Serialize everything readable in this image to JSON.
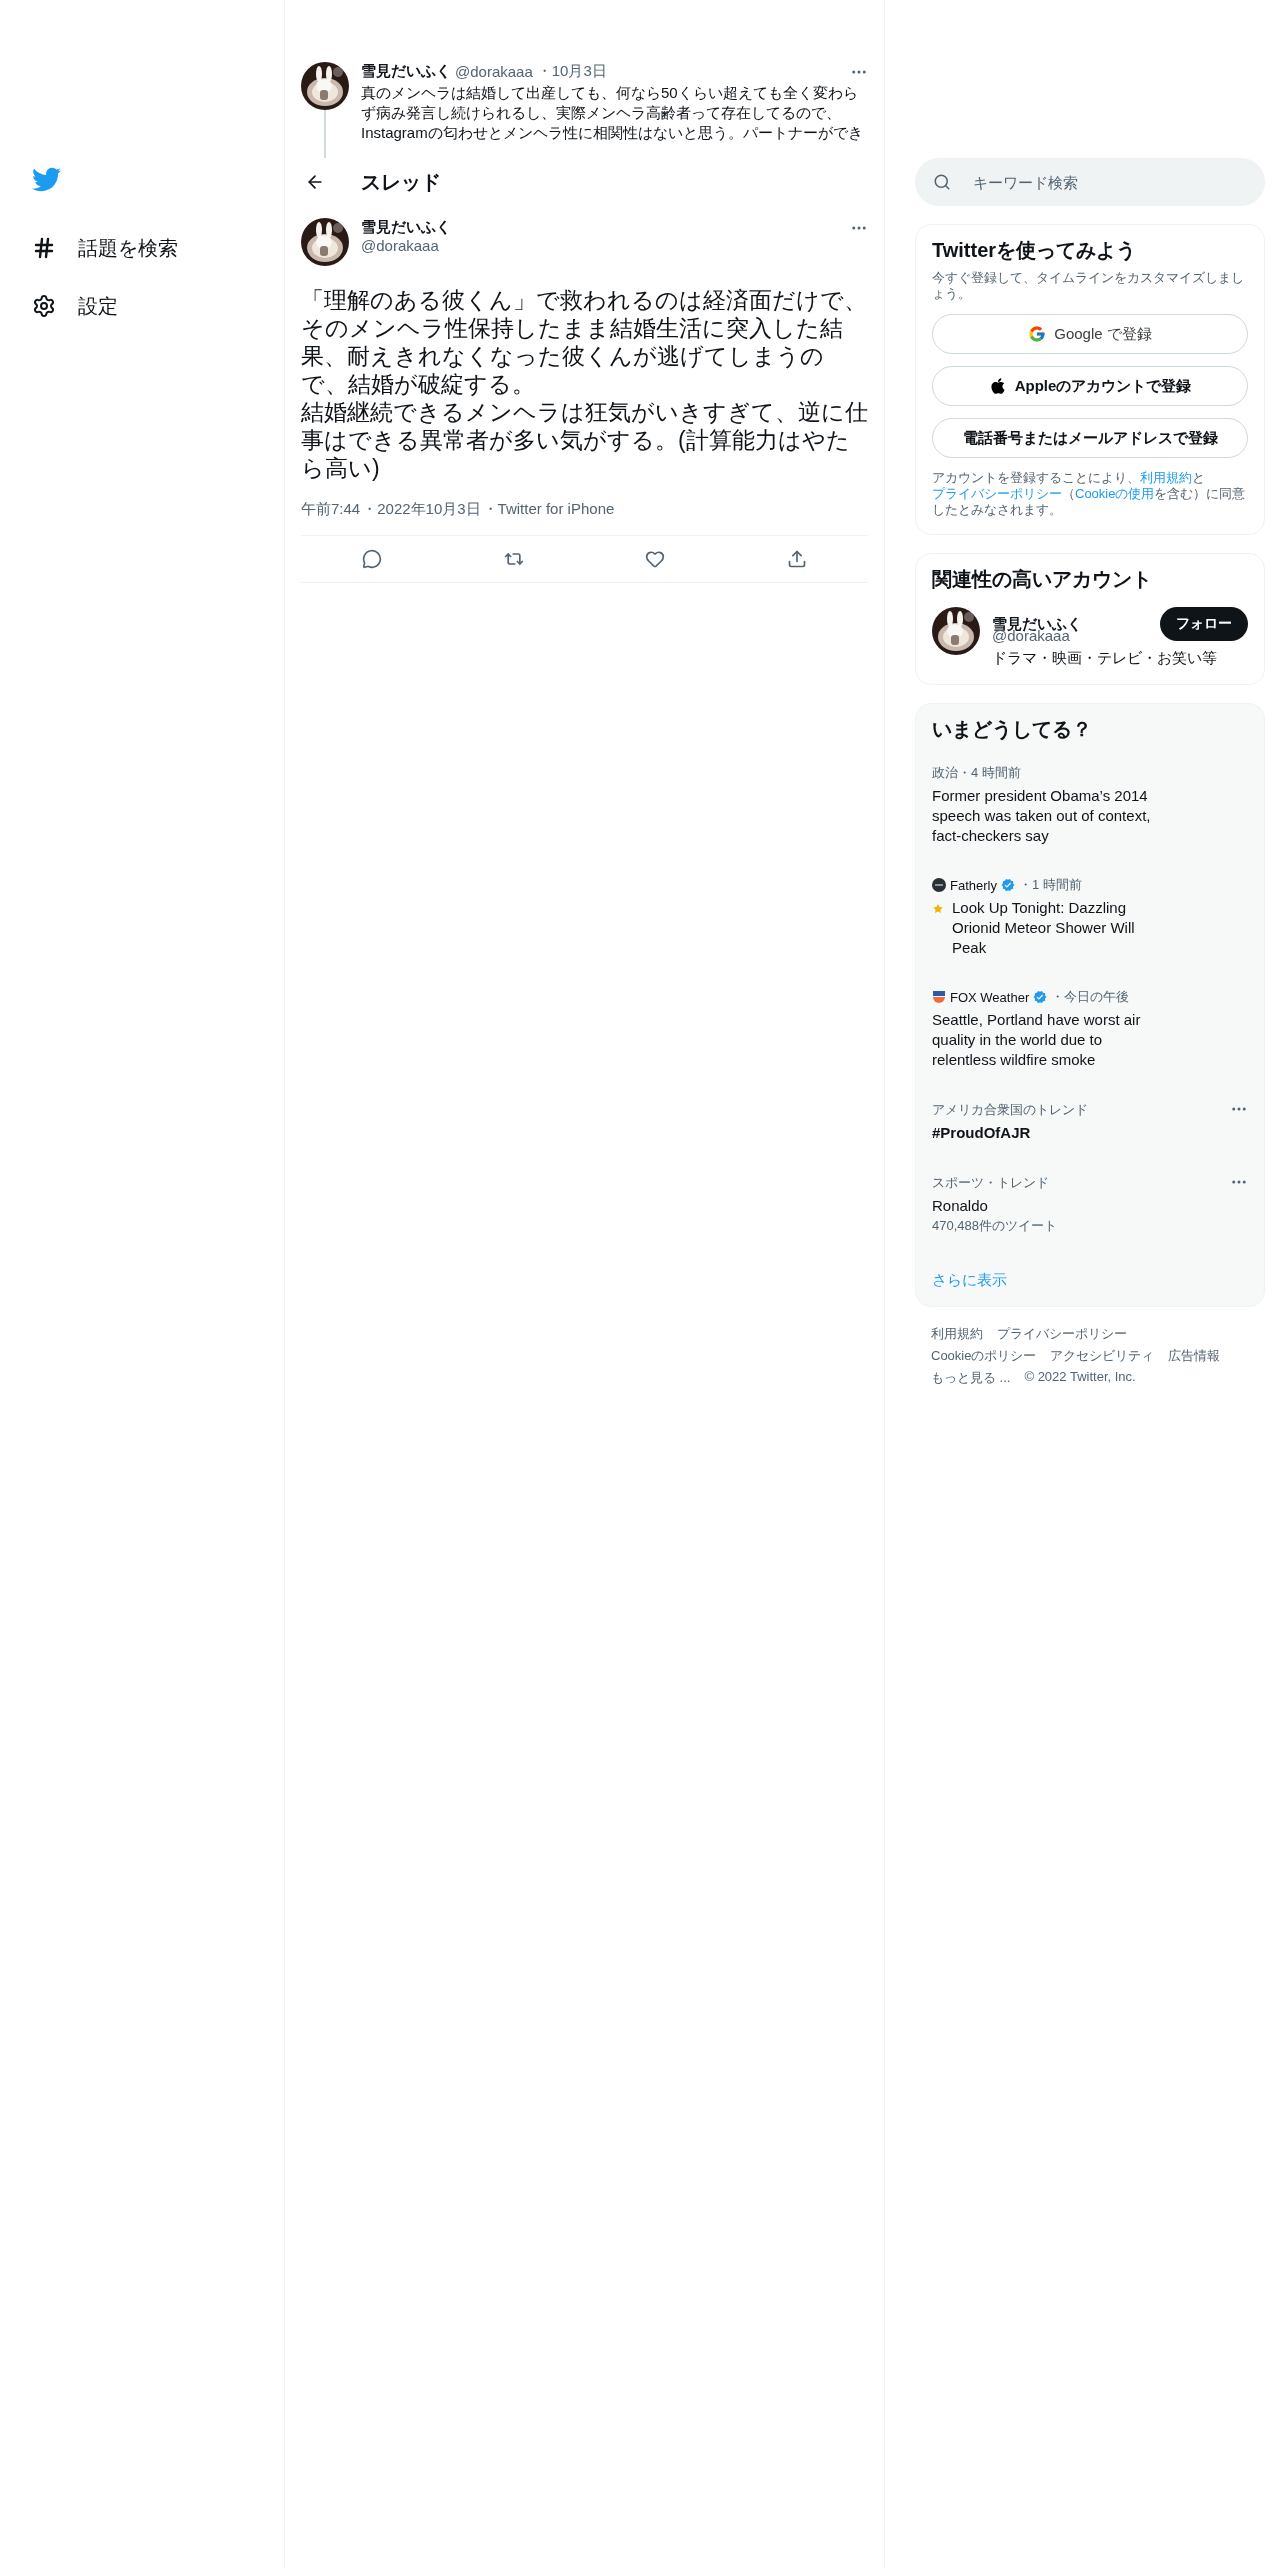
{
  "sidebar": {
    "items": [
      {
        "label": "話題を検索"
      },
      {
        "label": "設定"
      }
    ]
  },
  "thread": {
    "parent": {
      "name": "雪見だいふく",
      "handle": "@dorakaaa",
      "date": "・10月3日",
      "text": "真のメンヘラは結婚して出産しても、何なら50くらい超えても全く変わらず病み発言し続けられるし、実際メンヘラ高齢者って存在してるので、Instagramの匂わせとメンヘラ性に相関性はないと思う。パートナーができ"
    },
    "header": {
      "title": "スレッド"
    },
    "main": {
      "name": "雪見だいふく",
      "handle": "@dorakaaa",
      "paragraphs": [
        "「理解のある彼くん」で救われるのは経済面だけで、そのメンヘラ性保持したまま結婚生活に突入した結果、耐えきれなくなった彼くんが逃げてしまうので、結婚が破綻する。",
        "結婚継続できるメンヘラは狂気がいきすぎて、逆に仕事はできる異常者が多い気がする。(計算能力はやたら高い)"
      ],
      "meta": [
        "午前7:44",
        "・2022年10月3日",
        "・Twitter for iPhone"
      ]
    }
  },
  "search": {
    "placeholder": "キーワード検索"
  },
  "signup": {
    "title": "Twitterを使ってみよう",
    "subtitle": "今すぐ登録して、タイムラインをカスタマイズしましょう。",
    "buttons": [
      {
        "kind": "google",
        "label": "Google で登録"
      },
      {
        "kind": "apple",
        "label": "Appleのアカウントで登録"
      },
      {
        "kind": "plain",
        "label": "電話番号またはメールアドレスで登録"
      }
    ],
    "terms": [
      {
        "text": "アカウントを登録することにより、",
        "link": false
      },
      {
        "text": "利用規約",
        "link": true
      },
      {
        "text": "と",
        "link": false
      },
      {
        "text": "プライバシーポリシー",
        "link": true
      },
      {
        "text": "（",
        "link": false
      },
      {
        "text": "Cookieの使用",
        "link": true
      },
      {
        "text": "を含む）に同意したとみなされます。",
        "link": false
      }
    ]
  },
  "related": {
    "title": "関連性の高いアカウント",
    "account": {
      "name": "雪見だいふく",
      "handle": "@dorakaaa",
      "bio": "ドラマ・映画・テレビ・お笑い等",
      "button": "フォロー"
    }
  },
  "trends": {
    "title": "いまどうしてる？",
    "items": [
      {
        "kind": "news",
        "context": "政治・4 時間前",
        "headline": "Former president Obama’s 2014 speech was taken out of context, fact-checkers say"
      },
      {
        "kind": "source",
        "source": "Fatherly",
        "verified": true,
        "time": "・1 時間前",
        "star": true,
        "headline": "Look Up Tonight: Dazzling Orionid Meteor Shower Will Peak"
      },
      {
        "kind": "source",
        "source": "FOX Weather",
        "verified": true,
        "time": "・今日の午後",
        "headline": "Seattle, Portland have worst air quality in the world due to relentless wildfire smoke"
      },
      {
        "kind": "trend",
        "context": "アメリカ合衆国のトレンド",
        "title": "#ProudOfAJR",
        "bold": true
      },
      {
        "kind": "trend",
        "context": "スポーツ・トレンド",
        "title": "Ronaldo",
        "bold": false,
        "count": "470,488件のツイート"
      }
    ],
    "more": "さらに表示"
  },
  "footer": {
    "lines": [
      [
        "利用規約",
        "プライバシーポリシー"
      ],
      [
        "Cookieのポリシー",
        "アクセシビリティ",
        "広告情報"
      ],
      [
        "もっと見る ...",
        "© 2022 Twitter, Inc."
      ]
    ]
  }
}
